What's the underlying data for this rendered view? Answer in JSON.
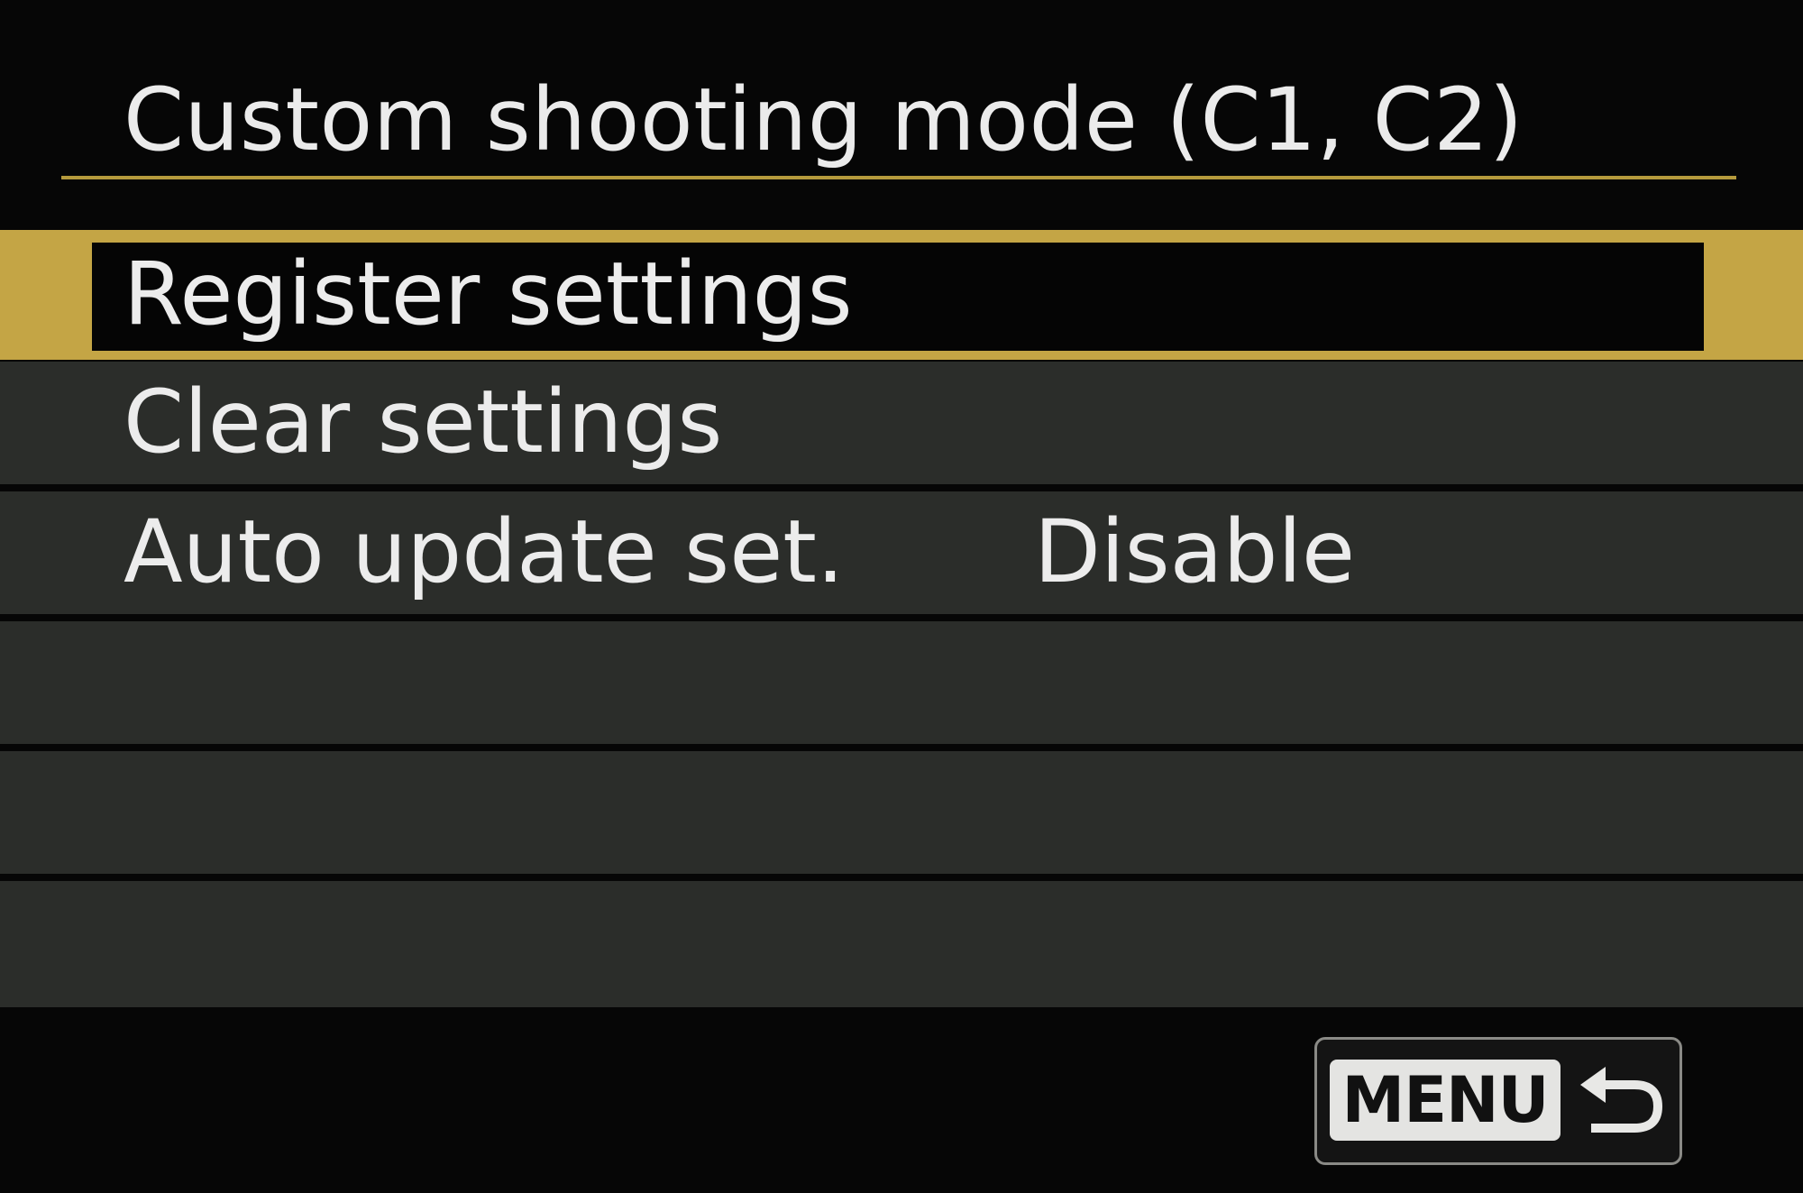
{
  "screen": {
    "title": "Custom shooting mode (C1, C2)"
  },
  "menu": {
    "items": [
      {
        "label": "Register settings",
        "value": "",
        "selected": true
      },
      {
        "label": "Clear settings",
        "value": "",
        "selected": false
      },
      {
        "label": "Auto update set.",
        "value": "Disable",
        "selected": false
      }
    ]
  },
  "footer": {
    "menu_button_label": "MENU",
    "back_icon": "return-arrow-icon"
  },
  "colors": {
    "accent": "#c4a545",
    "row_background": "#2b2d2a",
    "background": "#060606",
    "text": "#ececec"
  }
}
